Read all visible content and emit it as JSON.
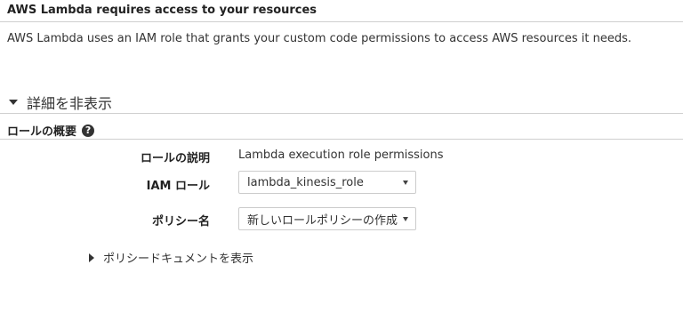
{
  "header": {
    "title": "AWS Lambda requires access to your resources",
    "description": "AWS Lambda uses an IAM role that grants your custom code permissions to access AWS resources it needs."
  },
  "details_toggle": {
    "label": "詳細を非表示",
    "state": "expanded"
  },
  "role_summary": {
    "title": "ロールの概要",
    "help_icon": "question-circle-icon"
  },
  "form": {
    "role_description": {
      "label": "ロールの説明",
      "value": "Lambda execution role permissions"
    },
    "iam_role": {
      "label": "IAM ロール",
      "selected": "lambda_kinesis_role"
    },
    "policy_name": {
      "label": "ポリシー名",
      "selected": "新しいロールポリシーの作成"
    }
  },
  "policy_document_toggle": {
    "label": "ポリシードキュメントを表示",
    "state": "collapsed"
  }
}
